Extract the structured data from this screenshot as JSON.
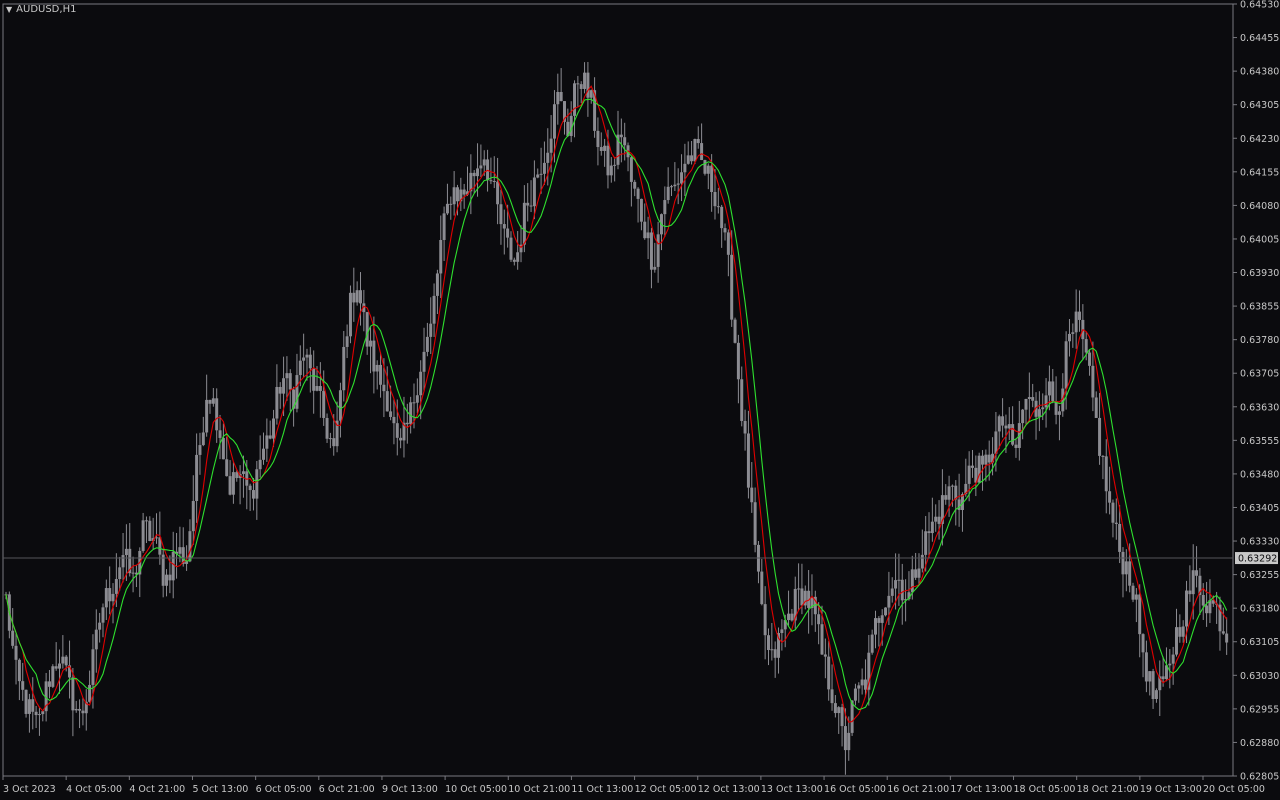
{
  "window": {
    "symbol": "AUDUSD,H1",
    "dropdown_icon": "triangle-down-icon"
  },
  "colors": {
    "background": "#0b0b0e",
    "axis": "#7a7a80",
    "text": "#c8c8c8",
    "candle": "#8c8c92",
    "ma_fast": "#e00000",
    "ma_slow": "#2ee02e",
    "bid_line": "#55555a",
    "bid_label_bg": "#c8c8c8",
    "bid_label_text": "#0b0b0e"
  },
  "chart_data": {
    "type": "candlestick",
    "symbol": "AUDUSD",
    "timeframe": "H1",
    "y_range": [
      0.62805,
      0.6453
    ],
    "y_ticks": [
      "0.64530",
      "0.64455",
      "0.64380",
      "0.64305",
      "0.64230",
      "0.64155",
      "0.64080",
      "0.64005",
      "0.63930",
      "0.63855",
      "0.63780",
      "0.63705",
      "0.63630",
      "0.63555",
      "0.63480",
      "0.63405",
      "0.63330",
      "0.63255",
      "0.63180",
      "0.63105",
      "0.63030",
      "0.62955",
      "0.62880",
      "0.62805"
    ],
    "current_price": "0.63292",
    "x_ticks": [
      "3 Oct 2023",
      "4 Oct 05:00",
      "4 Oct 21:00",
      "5 Oct 13:00",
      "6 Oct 05:00",
      "6 Oct 21:00",
      "9 Oct 13:00",
      "10 Oct 05:00",
      "10 Oct 21:00",
      "11 Oct 13:00",
      "12 Oct 05:00",
      "12 Oct 13:00",
      "13 Oct 13:00",
      "16 Oct 05:00",
      "16 Oct 21:00",
      "17 Oct 13:00",
      "18 Oct 05:00",
      "18 Oct 21:00",
      "19 Oct 13:00",
      "20 Oct 05:00"
    ],
    "close_path": [
      0.632,
      0.6302,
      0.6296,
      0.6291,
      0.6302,
      0.6308,
      0.63,
      0.6293,
      0.6303,
      0.6318,
      0.6323,
      0.633,
      0.6324,
      0.6336,
      0.6333,
      0.6324,
      0.6331,
      0.6329,
      0.635,
      0.6368,
      0.636,
      0.6345,
      0.6348,
      0.6343,
      0.6352,
      0.6358,
      0.637,
      0.6365,
      0.6375,
      0.6368,
      0.636,
      0.6352,
      0.638,
      0.6392,
      0.6378,
      0.637,
      0.6365,
      0.6352,
      0.636,
      0.6372,
      0.638,
      0.64,
      0.6412,
      0.641,
      0.6415,
      0.642,
      0.641,
      0.64,
      0.6395,
      0.6408,
      0.6415,
      0.6422,
      0.6432,
      0.6425,
      0.6438,
      0.6432,
      0.642,
      0.6415,
      0.6425,
      0.6412,
      0.6405,
      0.6395,
      0.641,
      0.6412,
      0.6418,
      0.642,
      0.6415,
      0.641,
      0.6395,
      0.637,
      0.6345,
      0.632,
      0.6305,
      0.6312,
      0.6318,
      0.6322,
      0.6318,
      0.6306,
      0.6298,
      0.6287,
      0.6298,
      0.6302,
      0.6315,
      0.6322,
      0.6325,
      0.632,
      0.633,
      0.6335,
      0.634,
      0.6345,
      0.6342,
      0.635,
      0.6348,
      0.6355,
      0.636,
      0.6352,
      0.6365,
      0.6362,
      0.6368,
      0.6362,
      0.6376,
      0.6382,
      0.637,
      0.6355,
      0.634,
      0.633,
      0.6325,
      0.631,
      0.6298,
      0.63,
      0.631,
      0.6318,
      0.6325,
      0.632,
      0.6318,
      0.6312
    ]
  }
}
